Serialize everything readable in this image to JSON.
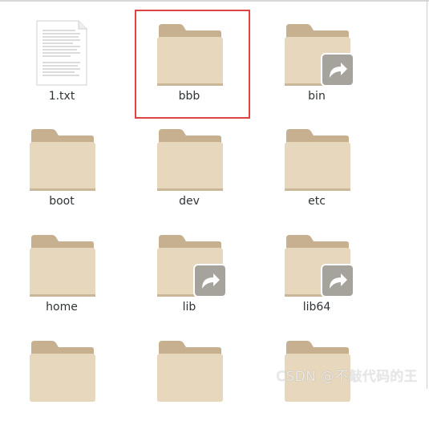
{
  "files": [
    {
      "name": "1.txt",
      "kind": "text"
    },
    {
      "name": "bbb",
      "kind": "folder",
      "selected": true
    },
    {
      "name": "bin",
      "kind": "folder-link"
    },
    {
      "name": "boot",
      "kind": "folder"
    },
    {
      "name": "dev",
      "kind": "folder"
    },
    {
      "name": "etc",
      "kind": "folder"
    },
    {
      "name": "home",
      "kind": "folder"
    },
    {
      "name": "lib",
      "kind": "folder-link"
    },
    {
      "name": "lib64",
      "kind": "folder-link"
    },
    {
      "name": "",
      "kind": "folder"
    },
    {
      "name": "",
      "kind": "folder"
    },
    {
      "name": "",
      "kind": "folder"
    }
  ],
  "watermark": "CSDN @不敲代码的王",
  "colors": {
    "folder_body": "#e7d7bd",
    "folder_tab": "#c7b08f",
    "folder_shadow": "#c9b798",
    "link_badge": "#a5a39b",
    "selection": "#e04343"
  }
}
